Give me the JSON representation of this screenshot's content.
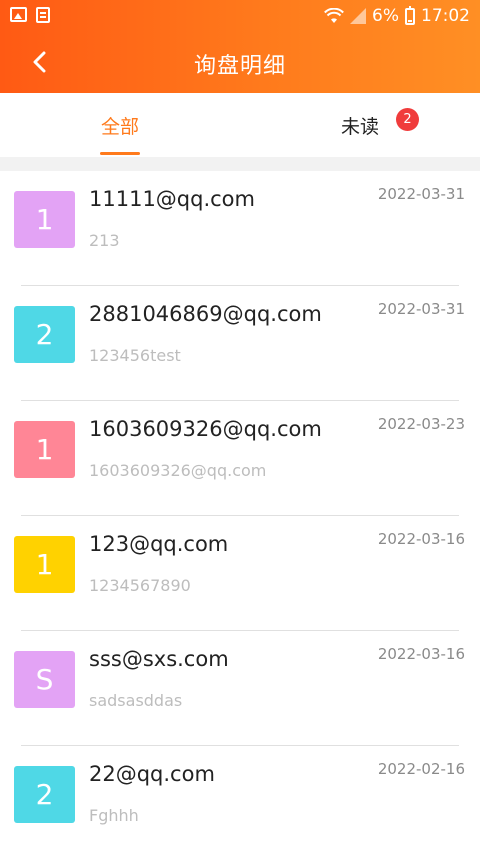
{
  "status_bar": {
    "battery_pct": "6%",
    "time": "17:02"
  },
  "header": {
    "title": "询盘明细"
  },
  "tabs": [
    {
      "label": "全部"
    },
    {
      "label": "未读",
      "badge": "2"
    }
  ],
  "items": [
    {
      "initial": "1",
      "email": "11111@qq.com",
      "snippet": "213",
      "date": "2022-03-31",
      "color": "#e3a3f5"
    },
    {
      "initial": "2",
      "email": "2881046869@qq.com",
      "snippet": "123456test",
      "date": "2022-03-31",
      "color": "#4fd8e6"
    },
    {
      "initial": "1",
      "email": "1603609326@qq.com",
      "snippet": "1603609326@qq.com",
      "date": "2022-03-23",
      "color": "#ff8696"
    },
    {
      "initial": "1",
      "email": "123@qq.com",
      "snippet": "1234567890",
      "date": "2022-03-16",
      "color": "#ffd200"
    },
    {
      "initial": "S",
      "email": "sss@sxs.com",
      "snippet": "sadsasddas",
      "date": "2022-03-16",
      "color": "#e3a3f5"
    },
    {
      "initial": "2",
      "email": "22@qq.com",
      "snippet": "Fghhh",
      "date": "2022-02-16",
      "color": "#4fd8e6"
    }
  ]
}
